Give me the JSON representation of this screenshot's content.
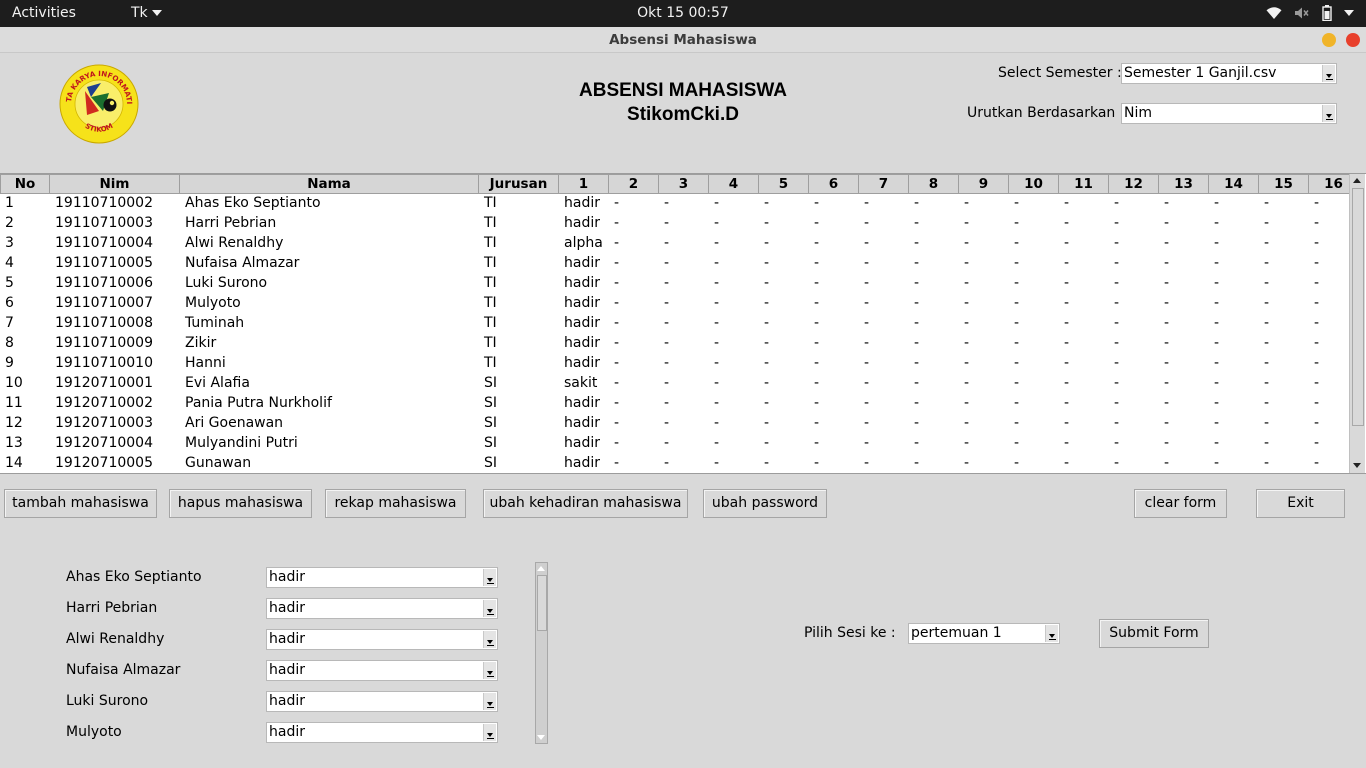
{
  "topbar": {
    "activities": "Activities",
    "app_menu": "Tk",
    "clock": "Okt 15  00:57",
    "tray_icons": [
      "wifi-icon",
      "volume-muted-icon",
      "battery-icon",
      "system-menu-caret-icon"
    ]
  },
  "window": {
    "title": "Absensi Mahasiswa",
    "controls": [
      "minimize-button",
      "close-button"
    ],
    "colors": {
      "minimize": "#f0b429",
      "close": "#e8402c"
    }
  },
  "header": {
    "logo_text": "CIPTA KARYA INFORMATIKA · STIKOM",
    "title_line1": "ABSENSI MAHASISWA",
    "title_line2": "StikomCki.D",
    "semester_label": "Select Semester :",
    "semester_value": "Semester 1 Ganjil.csv",
    "sort_label": "Urutkan Berdasarkan :",
    "sort_value": "Nim"
  },
  "table": {
    "columns": [
      "No",
      "Nim",
      "Nama",
      "Jurusan",
      "1",
      "2",
      "3",
      "4",
      "5",
      "6",
      "7",
      "8",
      "9",
      "10",
      "11",
      "12",
      "13",
      "14",
      "15",
      "16"
    ],
    "rows": [
      [
        "1",
        "19110710002",
        "Ahas Eko Septianto",
        "TI",
        "hadir",
        "-",
        "-",
        "-",
        "-",
        "-",
        "-",
        "-",
        "-",
        "-",
        "-",
        "-",
        "-",
        "-",
        "-",
        "-"
      ],
      [
        "2",
        "19110710003",
        "Harri Pebrian",
        "TI",
        "hadir",
        "-",
        "-",
        "-",
        "-",
        "-",
        "-",
        "-",
        "-",
        "-",
        "-",
        "-",
        "-",
        "-",
        "-",
        "-"
      ],
      [
        "3",
        "19110710004",
        "Alwi Renaldhy",
        "TI",
        "alpha",
        "-",
        "-",
        "-",
        "-",
        "-",
        "-",
        "-",
        "-",
        "-",
        "-",
        "-",
        "-",
        "-",
        "-",
        "-"
      ],
      [
        "4",
        "19110710005",
        "Nufaisa Almazar",
        "TI",
        "hadir",
        "-",
        "-",
        "-",
        "-",
        "-",
        "-",
        "-",
        "-",
        "-",
        "-",
        "-",
        "-",
        "-",
        "-",
        "-"
      ],
      [
        "5",
        "19110710006",
        "Luki Surono",
        "TI",
        "hadir",
        "-",
        "-",
        "-",
        "-",
        "-",
        "-",
        "-",
        "-",
        "-",
        "-",
        "-",
        "-",
        "-",
        "-",
        "-"
      ],
      [
        "6",
        "19110710007",
        "Mulyoto",
        "TI",
        "hadir",
        "-",
        "-",
        "-",
        "-",
        "-",
        "-",
        "-",
        "-",
        "-",
        "-",
        "-",
        "-",
        "-",
        "-",
        "-"
      ],
      [
        "7",
        "19110710008",
        "Tuminah",
        "TI",
        "hadir",
        "-",
        "-",
        "-",
        "-",
        "-",
        "-",
        "-",
        "-",
        "-",
        "-",
        "-",
        "-",
        "-",
        "-",
        "-"
      ],
      [
        "8",
        "19110710009",
        "Zikir",
        "TI",
        "hadir",
        "-",
        "-",
        "-",
        "-",
        "-",
        "-",
        "-",
        "-",
        "-",
        "-",
        "-",
        "-",
        "-",
        "-",
        "-"
      ],
      [
        "9",
        "19110710010",
        "Hanni",
        "TI",
        "hadir",
        "-",
        "-",
        "-",
        "-",
        "-",
        "-",
        "-",
        "-",
        "-",
        "-",
        "-",
        "-",
        "-",
        "-",
        "-"
      ],
      [
        "10",
        "19120710001",
        "Evi Alafia",
        "SI",
        "sakit",
        "-",
        "-",
        "-",
        "-",
        "-",
        "-",
        "-",
        "-",
        "-",
        "-",
        "-",
        "-",
        "-",
        "-",
        "-"
      ],
      [
        "11",
        "19120710002",
        "Pania Putra Nurkholif",
        "SI",
        "hadir",
        "-",
        "-",
        "-",
        "-",
        "-",
        "-",
        "-",
        "-",
        "-",
        "-",
        "-",
        "-",
        "-",
        "-",
        "-"
      ],
      [
        "12",
        "19120710003",
        "Ari Goenawan",
        "SI",
        "hadir",
        "-",
        "-",
        "-",
        "-",
        "-",
        "-",
        "-",
        "-",
        "-",
        "-",
        "-",
        "-",
        "-",
        "-",
        "-"
      ],
      [
        "13",
        "19120710004",
        "Mulyandini Putri",
        "SI",
        "hadir",
        "-",
        "-",
        "-",
        "-",
        "-",
        "-",
        "-",
        "-",
        "-",
        "-",
        "-",
        "-",
        "-",
        "-",
        "-"
      ],
      [
        "14",
        "19120710005",
        "Gunawan",
        "SI",
        "hadir",
        "-",
        "-",
        "-",
        "-",
        "-",
        "-",
        "-",
        "-",
        "-",
        "-",
        "-",
        "-",
        "-",
        "-",
        "-"
      ]
    ]
  },
  "buttons": {
    "tambah": "tambah mahasiswa",
    "hapus": "hapus mahasiswa",
    "rekap": "rekap mahasiswa",
    "ubah_kehadiran": "ubah kehadiran mahasiswa",
    "ubah_password": "ubah password",
    "clear_form": "clear form",
    "exit": "Exit"
  },
  "attendance_form": {
    "entries": [
      {
        "name": "Ahas Eko Septianto",
        "status": "hadir"
      },
      {
        "name": "Harri Pebrian",
        "status": "hadir"
      },
      {
        "name": "Alwi Renaldhy",
        "status": "hadir"
      },
      {
        "name": "Nufaisa Almazar",
        "status": "hadir"
      },
      {
        "name": "Luki Surono",
        "status": "hadir"
      },
      {
        "name": "Mulyoto",
        "status": "hadir"
      }
    ]
  },
  "session": {
    "label": "Pilih Sesi ke :",
    "value": "pertemuan 1",
    "submit": "Submit Form"
  }
}
